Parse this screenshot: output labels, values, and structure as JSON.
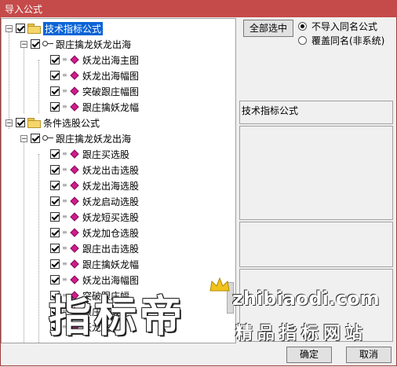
{
  "window": {
    "title": "导入公式"
  },
  "tree": {
    "root1": "技术指标公式",
    "group1": "跟庄擒龙妖龙出海",
    "group1_items": [
      "妖龙出海主图",
      "妖龙出海幅图",
      "突破跟庄幅图",
      "跟庄擒妖龙幅"
    ],
    "root2": "条件选股公式",
    "group2": "跟庄擒龙妖龙出海",
    "group2_items": [
      "跟庄买选股",
      "妖龙出击选股",
      "妖龙出海选股",
      "妖龙启动选股",
      "妖龙短买选股",
      "妖龙加仓选股",
      "跟庄出击选股",
      "跟庄擒妖龙幅",
      "妖龙出海幅图",
      "突破跟庄幅",
      "跟庄突破",
      "妖龙飞"
    ]
  },
  "controls": {
    "select_all": "全部选中",
    "radio_no_import": "不导入同名公式",
    "radio_overwrite": "覆盖同名(非系统)",
    "info_label": "技术指标公式",
    "ok": "确定",
    "cancel": "取消"
  },
  "watermark": {
    "cn": "指标帝",
    "domain": "zhibiaodi.com",
    "slogan": "精品指标网站"
  }
}
